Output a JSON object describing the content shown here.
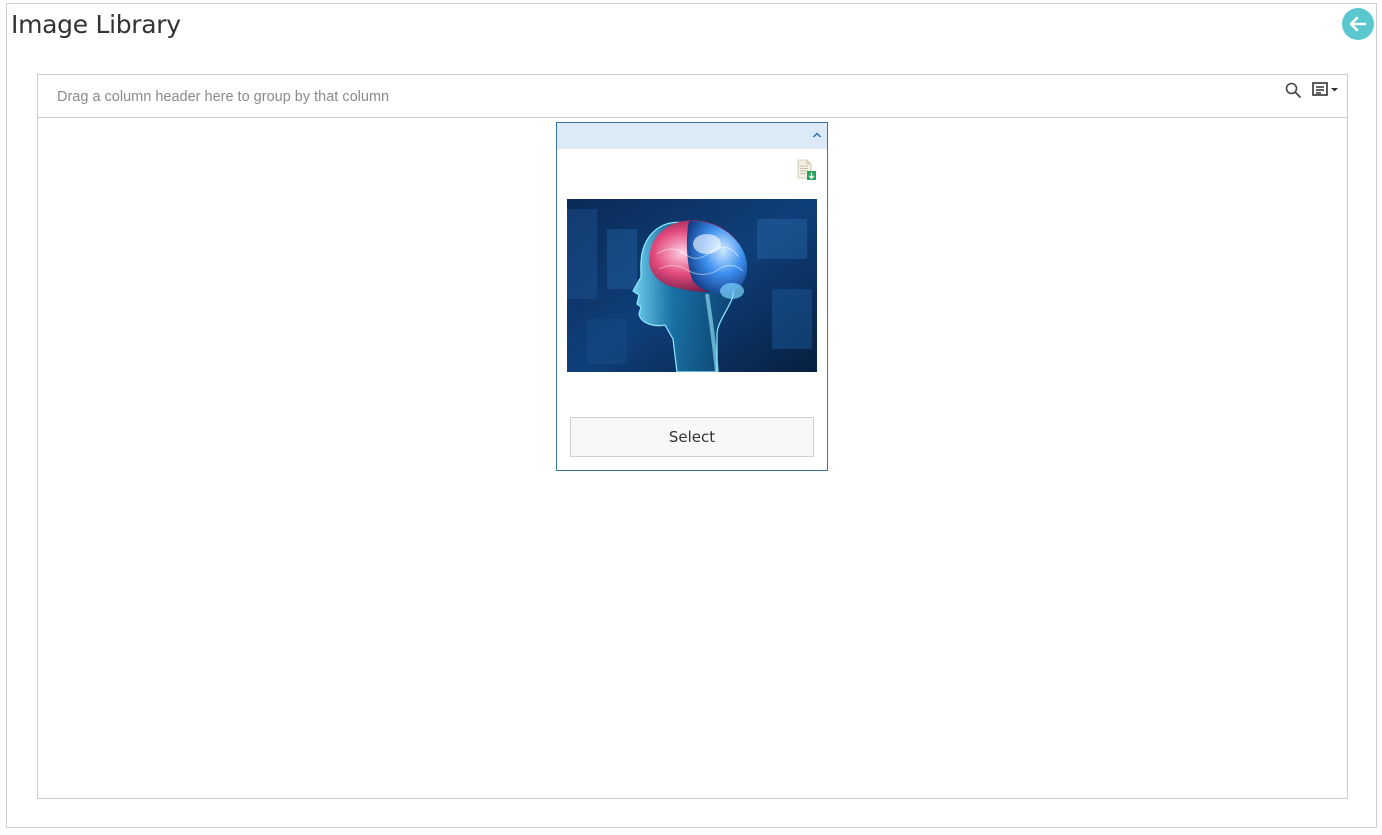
{
  "page": {
    "title": "Image Library"
  },
  "grid": {
    "group_panel_hint": "Drag a column header here to group by that column"
  },
  "card": {
    "select_label": "Select"
  },
  "colors": {
    "accent_back": "#5bc7cf",
    "card_border": "#3a73a8",
    "card_header": "#dceaf8"
  },
  "icons": {
    "back": "arrow-left-icon",
    "search": "search-icon",
    "column_chooser": "column-chooser-icon",
    "collapse": "chevron-up-icon",
    "download": "file-download-icon"
  }
}
